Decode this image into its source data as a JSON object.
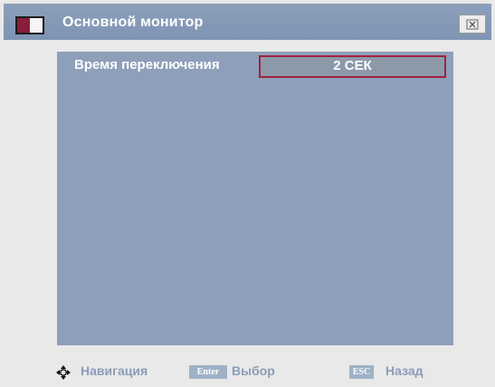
{
  "window": {
    "title": "Основной монитор",
    "close_glyph": "✕"
  },
  "setting": {
    "label": "Время переключения",
    "value": "2 СЕК"
  },
  "footer": {
    "navigation_label": "Навигация",
    "enter_key": "Enter",
    "enter_label": "Выбор",
    "esc_key": "ESC",
    "esc_label": "Назад"
  },
  "icons": {
    "app": "monitor-icon",
    "close": "close-icon",
    "navigation": "navigation-arrows-icon"
  },
  "colors": {
    "titlebar": "#8c9fbb",
    "panel": "#8e9fba",
    "accent": "#a1223f",
    "footer_text": "#8a9db8"
  }
}
